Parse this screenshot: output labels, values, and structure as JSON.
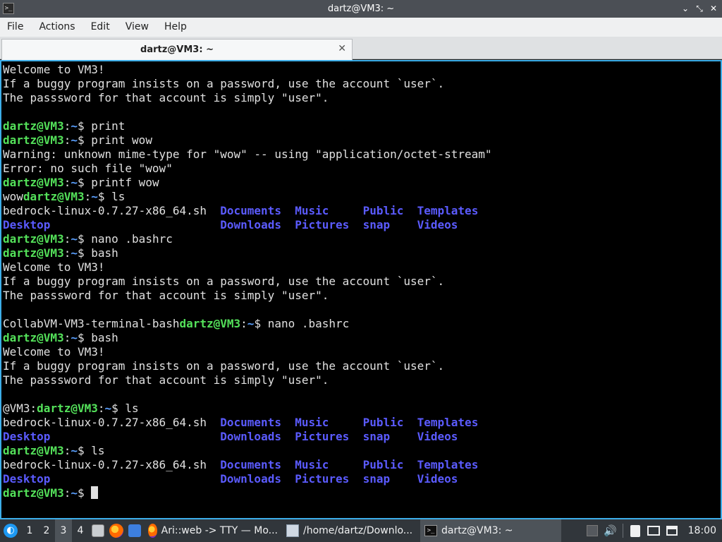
{
  "window": {
    "title": "dartz@VM3: ~",
    "controls": {
      "minimize": "⌄",
      "maximize": "⤡",
      "close": "✕"
    }
  },
  "menu": [
    "File",
    "Actions",
    "Edit",
    "View",
    "Help"
  ],
  "tab": {
    "label": "dartz@VM3: ~",
    "close": "✕"
  },
  "terminal": {
    "lines": [
      [
        {
          "t": "Welcome to VM3!"
        }
      ],
      [
        {
          "t": "If a buggy program insists on a password, use the account `user`."
        }
      ],
      [
        {
          "t": "The passsword for that account is simply \"user\"."
        }
      ],
      [],
      [
        {
          "t": "dartz@VM3",
          "c": "user"
        },
        {
          "t": ":"
        },
        {
          "t": "~",
          "c": "path"
        },
        {
          "t": "$ print"
        }
      ],
      [
        {
          "t": "dartz@VM3",
          "c": "user"
        },
        {
          "t": ":"
        },
        {
          "t": "~",
          "c": "path"
        },
        {
          "t": "$ print wow"
        }
      ],
      [
        {
          "t": "Warning: unknown mime-type for \"wow\" -- using \"application/octet-stream\""
        }
      ],
      [
        {
          "t": "Error: no such file \"wow\""
        }
      ],
      [
        {
          "t": "dartz@VM3",
          "c": "user"
        },
        {
          "t": ":"
        },
        {
          "t": "~",
          "c": "path"
        },
        {
          "t": "$ printf wow"
        }
      ],
      [
        {
          "t": "wow"
        },
        {
          "t": "dartz@VM3",
          "c": "user"
        },
        {
          "t": ":"
        },
        {
          "t": "~",
          "c": "path"
        },
        {
          "t": "$ ls"
        }
      ],
      [
        {
          "t": "bedrock-linux-0.7.27-x86_64.sh  "
        },
        {
          "t": "Documents",
          "c": "dir"
        },
        {
          "t": "  "
        },
        {
          "t": "Music",
          "c": "dir"
        },
        {
          "t": "     "
        },
        {
          "t": "Public",
          "c": "dir"
        },
        {
          "t": "  "
        },
        {
          "t": "Templates",
          "c": "dir"
        }
      ],
      [
        {
          "t": "Desktop",
          "c": "dir"
        },
        {
          "t": "                         "
        },
        {
          "t": "Downloads",
          "c": "dir"
        },
        {
          "t": "  "
        },
        {
          "t": "Pictures",
          "c": "dir"
        },
        {
          "t": "  "
        },
        {
          "t": "snap",
          "c": "dir"
        },
        {
          "t": "    "
        },
        {
          "t": "Videos",
          "c": "dir"
        }
      ],
      [
        {
          "t": "dartz@VM3",
          "c": "user"
        },
        {
          "t": ":"
        },
        {
          "t": "~",
          "c": "path"
        },
        {
          "t": "$ nano .bashrc"
        }
      ],
      [
        {
          "t": "dartz@VM3",
          "c": "user"
        },
        {
          "t": ":"
        },
        {
          "t": "~",
          "c": "path"
        },
        {
          "t": "$ bash"
        }
      ],
      [
        {
          "t": "Welcome to VM3!"
        }
      ],
      [
        {
          "t": "If a buggy program insists on a password, use the account `user`."
        }
      ],
      [
        {
          "t": "The passsword for that account is simply \"user\"."
        }
      ],
      [],
      [
        {
          "t": "CollabVM-VM3-terminal-bash"
        },
        {
          "t": "dartz@VM3",
          "c": "user"
        },
        {
          "t": ":"
        },
        {
          "t": "~",
          "c": "path"
        },
        {
          "t": "$ nano .bashrc"
        }
      ],
      [
        {
          "t": "dartz@VM3",
          "c": "user"
        },
        {
          "t": ":"
        },
        {
          "t": "~",
          "c": "path"
        },
        {
          "t": "$ bash"
        }
      ],
      [
        {
          "t": "Welcome to VM3!"
        }
      ],
      [
        {
          "t": "If a buggy program insists on a password, use the account `user`."
        }
      ],
      [
        {
          "t": "The passsword for that account is simply \"user\"."
        }
      ],
      [],
      [
        {
          "t": "@VM3:"
        },
        {
          "t": "dartz@VM3",
          "c": "user"
        },
        {
          "t": ":"
        },
        {
          "t": "~",
          "c": "path"
        },
        {
          "t": "$ ls"
        }
      ],
      [
        {
          "t": "bedrock-linux-0.7.27-x86_64.sh  "
        },
        {
          "t": "Documents",
          "c": "dir"
        },
        {
          "t": "  "
        },
        {
          "t": "Music",
          "c": "dir"
        },
        {
          "t": "     "
        },
        {
          "t": "Public",
          "c": "dir"
        },
        {
          "t": "  "
        },
        {
          "t": "Templates",
          "c": "dir"
        }
      ],
      [
        {
          "t": "Desktop",
          "c": "dir"
        },
        {
          "t": "                         "
        },
        {
          "t": "Downloads",
          "c": "dir"
        },
        {
          "t": "  "
        },
        {
          "t": "Pictures",
          "c": "dir"
        },
        {
          "t": "  "
        },
        {
          "t": "snap",
          "c": "dir"
        },
        {
          "t": "    "
        },
        {
          "t": "Videos",
          "c": "dir"
        }
      ],
      [
        {
          "t": "dartz@VM3",
          "c": "user"
        },
        {
          "t": ":"
        },
        {
          "t": "~",
          "c": "path"
        },
        {
          "t": "$ ls"
        }
      ],
      [
        {
          "t": "bedrock-linux-0.7.27-x86_64.sh  "
        },
        {
          "t": "Documents",
          "c": "dir"
        },
        {
          "t": "  "
        },
        {
          "t": "Music",
          "c": "dir"
        },
        {
          "t": "     "
        },
        {
          "t": "Public",
          "c": "dir"
        },
        {
          "t": "  "
        },
        {
          "t": "Templates",
          "c": "dir"
        }
      ],
      [
        {
          "t": "Desktop",
          "c": "dir"
        },
        {
          "t": "                         "
        },
        {
          "t": "Downloads",
          "c": "dir"
        },
        {
          "t": "  "
        },
        {
          "t": "Pictures",
          "c": "dir"
        },
        {
          "t": "  "
        },
        {
          "t": "snap",
          "c": "dir"
        },
        {
          "t": "    "
        },
        {
          "t": "Videos",
          "c": "dir"
        }
      ],
      [
        {
          "t": "dartz@VM3",
          "c": "user"
        },
        {
          "t": ":"
        },
        {
          "t": "~",
          "c": "path"
        },
        {
          "t": "$ "
        },
        {
          "t": "",
          "c": "cursor"
        }
      ]
    ]
  },
  "taskbar": {
    "desktops": [
      "1",
      "2",
      "3",
      "4"
    ],
    "active_desktop": "3",
    "tasks": [
      {
        "label": "Ari::web -> TTY — Mo...",
        "icon": "firefox-icon"
      },
      {
        "label": "/home/dartz/Downlo...",
        "icon": "text-editor-icon"
      },
      {
        "label": "dartz@VM3: ~",
        "icon": "terminal-icon"
      }
    ],
    "clock": "18:00"
  },
  "colors": {
    "prompt_user": "#54e15a",
    "prompt_path": "#5aa0ff",
    "directory": "#5b5bff",
    "focus_border": "#3daee9"
  }
}
